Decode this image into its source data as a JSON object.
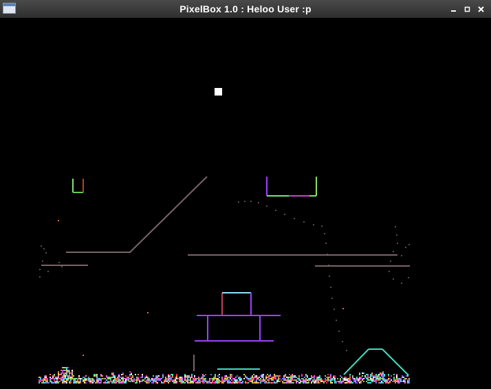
{
  "window": {
    "title": "PixelBox 1.0 : Heloo User :p",
    "controls": [
      "minimize",
      "maximize",
      "close"
    ],
    "icon": "window-app-icon"
  },
  "colors": {
    "background": "#000000",
    "titlebar": "#3a3a3a",
    "wall": "#7a6468",
    "cup_purple": "#a040ff",
    "bucket_green": "#7fe07f",
    "ramp_cyan": "#40e0c0"
  },
  "scene": {
    "cursor": "white-square-brush"
  }
}
